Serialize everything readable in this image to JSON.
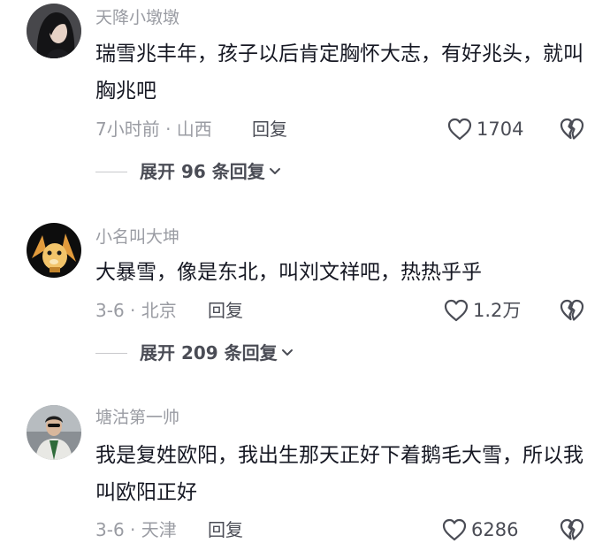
{
  "comments": [
    {
      "username": "天降小墩墩",
      "text": "瑞雪兆丰年，孩子以后肯定胸怀大志，有好兆头，就叫胸兆吧",
      "time_location": "7小时前 · 山西",
      "reply_label": "回复",
      "likes": "1704",
      "expand_label": "展开 96 条回复"
    },
    {
      "username": "小名叫大坤",
      "text": "大暴雪，像是东北，叫刘文祥吧，热热乎乎",
      "time_location": "3-6 · 北京",
      "reply_label": "回复",
      "likes": "1.2万",
      "expand_label": "展开 209 条回复"
    },
    {
      "username": "塘沽第一帅",
      "text": "我是复姓欧阳，我出生那天正好下着鹅毛大雪，所以我叫欧阳正好",
      "time_location": "3-6 · 天津",
      "reply_label": "回复",
      "likes": "6286"
    }
  ],
  "icons": {
    "like": "heart-outline-icon",
    "dislike": "broken-heart-icon",
    "expand": "chevron-down-icon"
  },
  "colors": {
    "text_primary": "#161823",
    "text_secondary": "#9a9ca3",
    "text_action": "#4a4c55"
  }
}
